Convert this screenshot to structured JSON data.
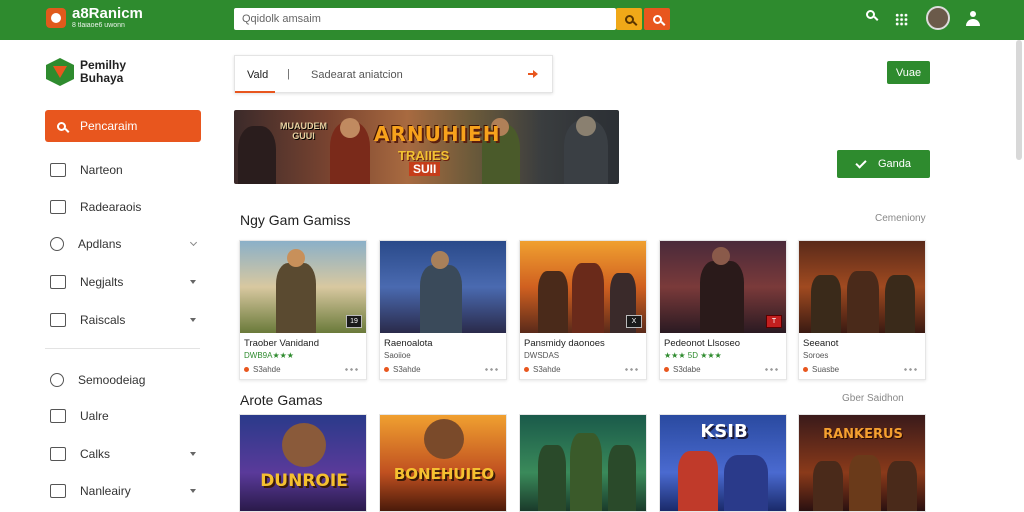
{
  "app": {
    "logo_title": "a8Ranicm",
    "logo_sub": "8 tlaiaoe6 uwonn"
  },
  "search": {
    "placeholder": "Qqidolk amsaim"
  },
  "sidebar": {
    "brand_line1": "Pemilhy",
    "brand_line2": "Buhaya",
    "primary_label": "Pencaraim",
    "items": [
      {
        "label": "Narteon",
        "icon": "calendar-icon"
      },
      {
        "label": "Radearaois",
        "icon": "document-icon"
      },
      {
        "label": "Apdlans",
        "icon": "wrench-icon"
      },
      {
        "label": "Negjalts",
        "icon": "note-icon"
      },
      {
        "label": "Raiscals",
        "icon": "list-icon"
      },
      {
        "label": "Semoodeiag",
        "icon": "cloud-icon"
      },
      {
        "label": "Ualre",
        "icon": "edit-icon"
      },
      {
        "label": "Calks",
        "icon": "folder-icon"
      },
      {
        "label": "Nanleairy",
        "icon": "home-icon"
      }
    ]
  },
  "tabs": {
    "active": "Vald",
    "separator": "|",
    "link": "Sadearat aniatcion"
  },
  "buttons": {
    "small": "Vuae",
    "check": "Ganda"
  },
  "banner": {
    "small_text_line1": "MUAUDEM",
    "small_text_line2": "GUUI",
    "title": "ARNUHIEH",
    "subtitle": "TRAIIES",
    "sign": "SUII"
  },
  "sections": {
    "new_games": {
      "title": "Ngy Gam Gamiss",
      "link": "Cemeniony",
      "cards": [
        {
          "name": "Traober Vanidand",
          "sub": "DWB9A★★★",
          "meta": "S3ahde",
          "badge": "19"
        },
        {
          "name": "Raenoalota",
          "sub": "Saoiioe",
          "meta": "S3ahde",
          "badge": ""
        },
        {
          "name": "Pansmidy daonoes",
          "sub": "DWSDAS",
          "meta": "S3ahde",
          "badge": "X"
        },
        {
          "name": "Pedeonot Llsoseo",
          "sub": "★★★ 5D ★★★",
          "meta": "S3dabe",
          "badge": "T"
        },
        {
          "name": "Seeanot",
          "sub": "Soroes",
          "meta": "Suasbe",
          "badge": ""
        }
      ]
    },
    "arcade_games": {
      "title": "Arote Gamas",
      "link": "Gber Saidhon",
      "cards": [
        {
          "art_title": "DUNROIE"
        },
        {
          "art_title": "BONEHUIEO"
        },
        {
          "art_title": ""
        },
        {
          "art_title": "KSIB"
        },
        {
          "art_title": "RANKERUS"
        }
      ]
    }
  },
  "colors": {
    "header_green": "#2e8b2e",
    "accent_orange": "#e8561e",
    "accent_yellow": "#f0a818"
  }
}
